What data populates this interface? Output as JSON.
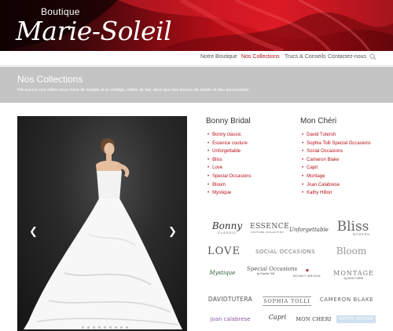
{
  "header": {
    "logo_top": "Boutique",
    "logo_script": "Marie-Soleil"
  },
  "nav": {
    "items": [
      {
        "label": "Notre Boutique",
        "active": false
      },
      {
        "label": "Nos Collections",
        "active": true
      },
      {
        "label": "Trucs & Conseils",
        "active": false
      },
      {
        "label": "Contactez-nous",
        "active": false
      }
    ],
    "search_icon": "search-icon"
  },
  "title_band": {
    "title": "Nos Collections",
    "subtitle": "Découvrez nos robes pour mère de mariée et le cortège, robes de bal, ainsi que des tenues de soirée et des accessoires"
  },
  "slider": {
    "prev_icon": "chevron-left-icon",
    "next_icon": "chevron-right-icon",
    "dot_count": 10,
    "active_dot": 0
  },
  "collections": [
    {
      "title": "Bonny Bridal",
      "items": [
        "Bonny classic",
        "Essence couture",
        "Unforgettable",
        "Bliss",
        "Love",
        "Special Occasions",
        "Bloom",
        "Mystique"
      ]
    },
    {
      "title": "Mon Chéri",
      "items": [
        "David Tutersh",
        "Sophia Tolli Special Occasions",
        "Social Occasions",
        "Cameron Blake",
        "Capri",
        "Montage",
        "Joan Calabrese",
        "Kathy Hilton"
      ]
    }
  ],
  "logos": {
    "row1": [
      "Bonny",
      "ESSENCE",
      "Unforgettable",
      "Bliss"
    ],
    "row1_sub": [
      "CLASSIC",
      "COUTURE COLLECTION",
      "",
      "MODERN"
    ],
    "row2": [
      "LOVE",
      "SOCIAL OCCASIONS",
      "Bloom"
    ],
    "row3": [
      "Mystique",
      "Special Occasions",
      "BONNY BRIDAL",
      "MONTAGE"
    ],
    "row3_sub": [
      "",
      "by Sophia Tolli",
      "",
      "by MON CHÉRI"
    ],
    "row4": [
      "DAVIDTUTERA",
      "SOPHIA TOLLI",
      "CAMERON BLAKE"
    ],
    "row5": [
      "joan calabrese",
      "Capri",
      "MON CHERI",
      "KATHY HILTON"
    ]
  }
}
